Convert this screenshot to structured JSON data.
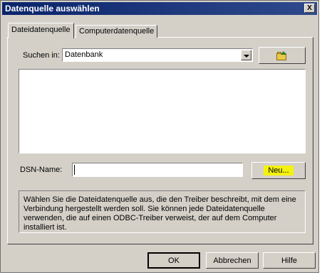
{
  "window": {
    "title": "Datenquelle auswählen",
    "close_label": "X"
  },
  "tabs": [
    {
      "label": "Dateidatenquelle",
      "active": true
    },
    {
      "label": "Computerdatenquelle",
      "active": false
    }
  ],
  "search": {
    "label": "Suchen in:",
    "value": "Datenbank"
  },
  "dsn": {
    "label": "DSN-Name:",
    "value": ""
  },
  "buttons": {
    "new": "Neu...",
    "ok": "OK",
    "cancel": "Abbrechen",
    "help": "Hilfe"
  },
  "info_text": "Wählen Sie die Dateidatenquelle aus, die den Treiber beschreibt, mit dem eine Verbindung hergestellt werden soll. Sie können jede Dateidatenquelle verwenden, die auf einen ODBC-Treiber verweist, der auf dem Computer installiert ist.",
  "colors": {
    "title_bg": "#0a246a",
    "dialog_bg": "#d4d0c8",
    "highlight": "#f4f10e"
  }
}
